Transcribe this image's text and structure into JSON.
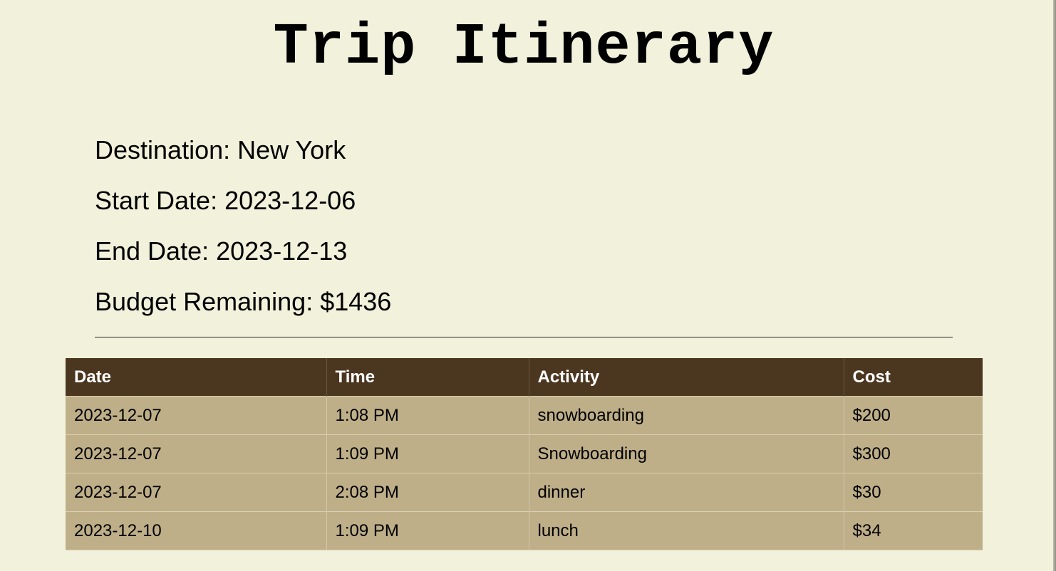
{
  "page": {
    "title": "Trip Itinerary"
  },
  "trip": {
    "destination_label": "Destination: New York",
    "start_label": "Start Date: 2023-12-06",
    "end_label": "End Date: 2023-12-13",
    "budget_label": "Budget Remaining: $1436"
  },
  "table": {
    "headers": [
      "Date",
      "Time",
      "Activity",
      "Cost"
    ],
    "rows": [
      [
        "2023-12-07",
        "1:08 PM",
        "snowboarding",
        "$200"
      ],
      [
        "2023-12-07",
        "1:09 PM",
        "Snowboarding",
        "$300"
      ],
      [
        "2023-12-07",
        "2:08 PM",
        "dinner",
        "$30"
      ],
      [
        "2023-12-10",
        "1:09 PM",
        "lunch",
        "$34"
      ]
    ]
  },
  "colors": {
    "background": "#f2f1db",
    "header_bg": "#4b361f",
    "row_bg": "#beaf88"
  }
}
